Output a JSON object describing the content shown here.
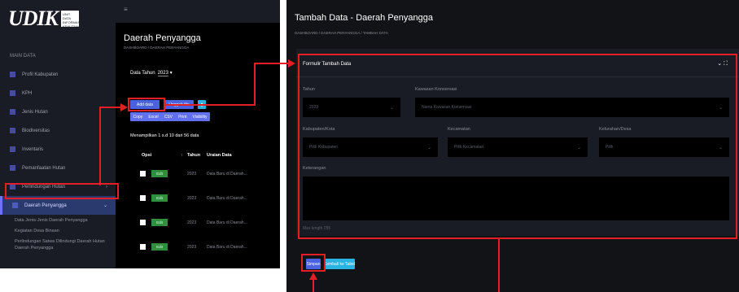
{
  "left": {
    "logo_text": "UDIK",
    "logo_mark": "UNIT DATA INFORMASI KEHUTANAN",
    "sidebar_header": "MAIN DATA",
    "menu": [
      {
        "label": "Profil Kabupaten",
        "icon": "document-icon"
      },
      {
        "label": "KPH",
        "icon": "tree-icon"
      },
      {
        "label": "Jenis Hutan",
        "icon": "forest-icon"
      },
      {
        "label": "Biodiversitas",
        "icon": "leaf-icon"
      },
      {
        "label": "Inventaris",
        "icon": "box-icon"
      },
      {
        "label": "Pemanfaatan Hutan",
        "icon": "chart-icon"
      },
      {
        "label": "Perlindungan Hutan",
        "icon": "shield-icon",
        "arrow": "›"
      },
      {
        "label": "Daerah Penyangga",
        "icon": "list-icon",
        "arrow": "⌄",
        "active": true
      }
    ],
    "submenu": [
      "Data Jenis-Jenis Daerah Penyangga",
      "Kegiatan Desa Binaan",
      "Perlindungan Satwa Dilindungi Daerah Hutan Daerah Penyangga"
    ],
    "page_title": "Daerah Penyangga",
    "breadcrumb": "DASHBOARD / DAERAH PENYANGGA",
    "data_tahun_label": "Data Tahun",
    "data_tahun_value": "2023",
    "btn_add": "Add data",
    "btn_import": "Unggah file",
    "btn_delete_icon": "trash-icon",
    "tools": [
      "Copy",
      "Excel",
      "CSV",
      "Print",
      "Visibility"
    ],
    "info": "Menampilkan 1 s.d 10 dari 56 data",
    "headers": [
      "Opsi",
      "Tahun",
      "Uraian Data"
    ],
    "rows": [
      {
        "status": "Edit",
        "year": "2023",
        "desc": "Data Baru di Daerah..."
      },
      {
        "status": "Edit",
        "year": "2023",
        "desc": "Data Baru di Daerah..."
      },
      {
        "status": "Edit",
        "year": "2023",
        "desc": "Data Baru di Daerah..."
      },
      {
        "status": "Edit",
        "year": "2023",
        "desc": "Data Baru di Daerah..."
      }
    ]
  },
  "right": {
    "title": "Tambah Data - Daerah Penyangga",
    "breadcrumb": "DASHBOARD / DAERAH PENYANGGA / TAMBAH DATA",
    "form_title": "Formulir Tambah Data",
    "fields": {
      "tahun_label": "Tahun",
      "tahun_value": "2023",
      "kawasan_label": "Kawasan Konservasi",
      "kawasan_value": "Nama Kawasan Konservasi",
      "kabupaten_label": "Kabupaten/Kota",
      "kabupaten_value": "Pilih Kabupaten",
      "kecamatan_label": "Kecamatan",
      "kecamatan_value": "Pilih Kecamatan",
      "desa_label": "Kelurahan/Desa",
      "desa_value": "Pilih",
      "keterangan_label": "Keterangan",
      "note": "Max length 255"
    },
    "btn_save": "Simpan",
    "btn_back": "Kembali ke Tabel"
  },
  "colors": {
    "accent": "#4a62e0",
    "annotation": "#e31e24",
    "cyan": "#2ab3e0"
  }
}
